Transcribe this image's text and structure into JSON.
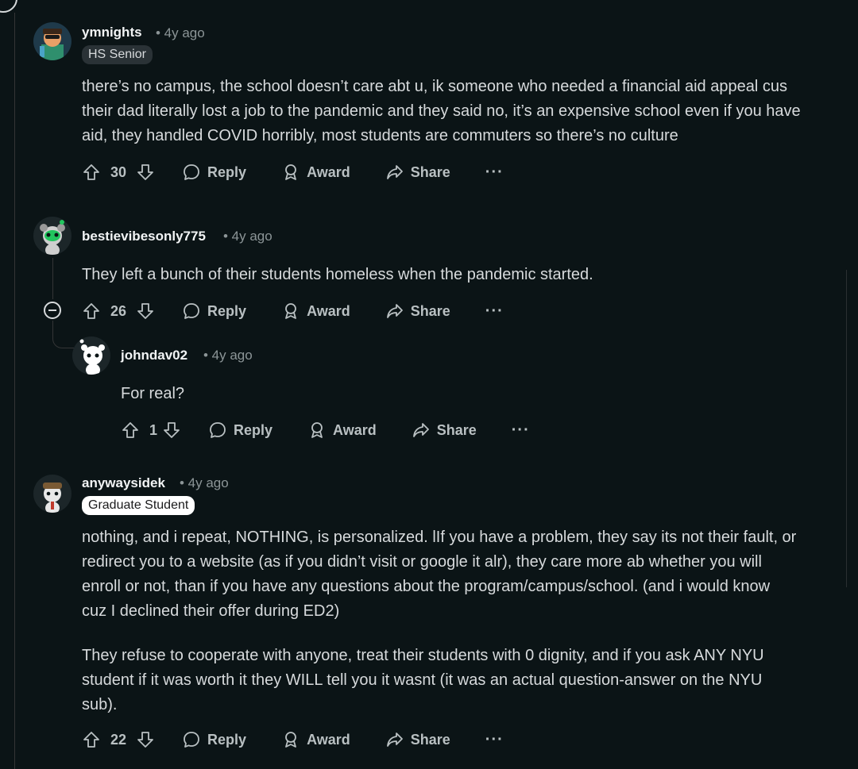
{
  "comments": [
    {
      "username": "ymnights",
      "time": "• 4y ago",
      "flair": "HS Senior",
      "body": [
        "there’s no campus, the school doesn’t care abt u, ik someone who needed a financial aid appeal cus their dad literally lost a job to the pandemic and they said no, it’s an expensive school even if you have aid, they handled COVID horribly, most students are commuters so there’s no culture"
      ],
      "votes": "30"
    },
    {
      "username": "bestievibesonly775",
      "time": "• 4y ago",
      "body": [
        "They left a bunch of their students homeless when the pandemic started."
      ],
      "votes": "26"
    },
    {
      "username": "johndav02",
      "time": "• 4y ago",
      "body": [
        "For real?"
      ],
      "votes": "1"
    },
    {
      "username": "anywaysidek",
      "time": "• 4y ago",
      "flair": "Graduate Student",
      "body": [
        "nothing, and i repeat, NOTHING, is personalized. lIf you have a problem, they say its not their fault, or redirect you to a website (as if you didn’t visit or google it alr), they care more ab whether you will enroll or not, than if you have any questions about the program/campus/school. (and i would know cuz I declined their offer during ED2)",
        "They refuse to cooperate with anyone, treat their students with 0 dignity, and if you ask ANY NYU student if it was worth it they WILL tell you it wasnt (it was an actual question-answer on the NYU sub)."
      ],
      "votes": "22"
    }
  ],
  "actions": {
    "reply": "Reply",
    "award": "Award",
    "share": "Share",
    "more": "···"
  },
  "icons": {
    "upvote": "upvote-icon",
    "downvote": "downvote-icon",
    "reply": "comment-bubble-icon",
    "award": "award-icon",
    "share": "share-arrow-icon",
    "more": "ellipsis-icon",
    "collapse": "collapse-minus-icon"
  },
  "colors": {
    "background": "#0b1416",
    "text": "#d7dadc",
    "muted": "#8c9597",
    "flair_dark": "#2a3236",
    "flair_light": "#ffffff"
  }
}
